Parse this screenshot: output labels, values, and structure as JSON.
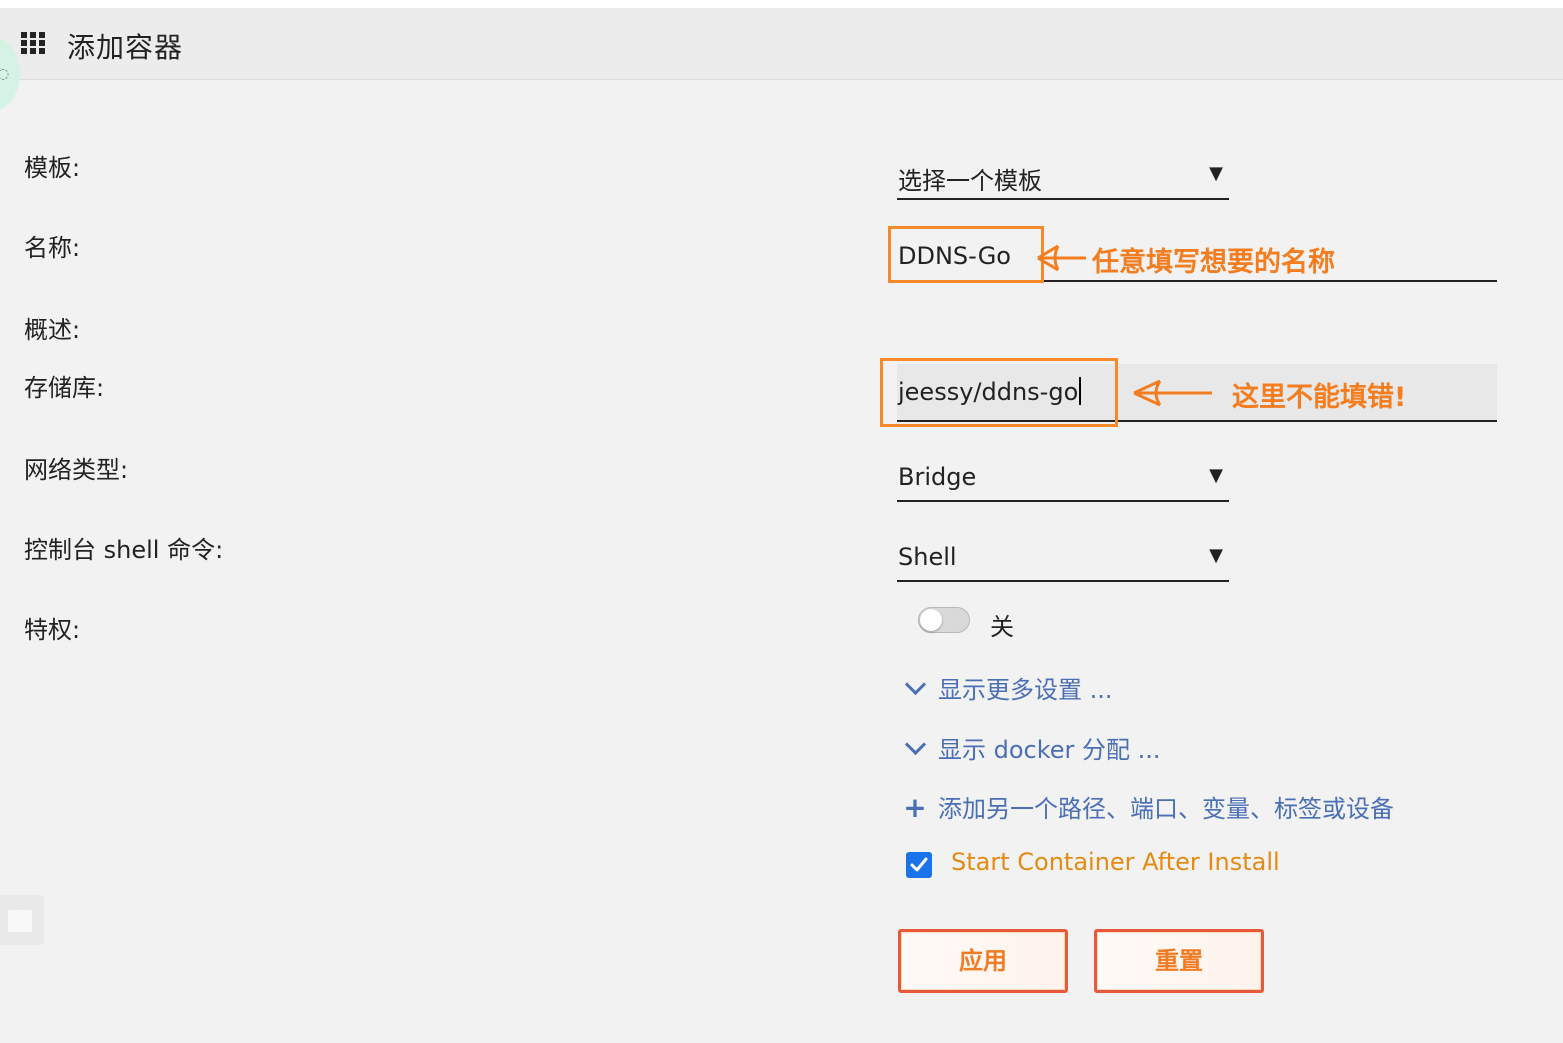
{
  "header": {
    "title": "添加容器",
    "icon": "grid-icon"
  },
  "form": {
    "template": {
      "label": "模板:",
      "value": "选择一个模板"
    },
    "name": {
      "label": "名称:",
      "value": "DDNS-Go"
    },
    "description": {
      "label": "概述:"
    },
    "repository": {
      "label": "存储库:",
      "value": "jeessy/ddns-go"
    },
    "network": {
      "label": "网络类型:",
      "value": "Bridge"
    },
    "console": {
      "label": "控制台 shell 命令:",
      "value": "Shell"
    },
    "privileged": {
      "label": "特权:",
      "state_label": "关",
      "enabled": false
    }
  },
  "links": {
    "more_settings": "显示更多设置 ...",
    "docker_allocation": "显示 docker 分配 ...",
    "add_another": "添加另一个路径、端口、变量、标签或设备"
  },
  "start_after_install": {
    "label": "Start Container After Install",
    "checked": true
  },
  "buttons": {
    "apply": "应用",
    "reset": "重置"
  },
  "annotations": {
    "name_hint": "任意填写想要的名称",
    "repo_hint": "这里不能填错!",
    "color": "#f47d20"
  },
  "colors": {
    "link": "#4a6fb5",
    "checkbox": "#1a73e8",
    "start_label": "#e38b12",
    "button_border": "#e8593a"
  }
}
